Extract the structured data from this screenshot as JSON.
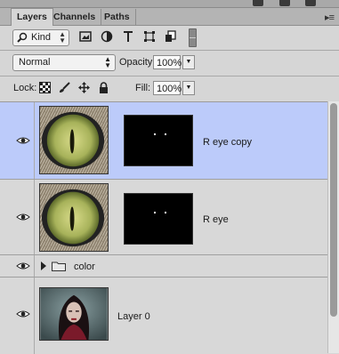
{
  "tabs": [
    {
      "label": "Layers",
      "active": true
    },
    {
      "label": "Channels",
      "active": false
    },
    {
      "label": "Paths",
      "active": false
    }
  ],
  "filter": {
    "kind_label": "Kind",
    "icons": [
      "pixel-filter-icon",
      "adjustment-filter-icon",
      "type-filter-icon",
      "shape-filter-icon",
      "smart-object-filter-icon",
      "filter-toggle-icon"
    ]
  },
  "blend": {
    "mode": "Normal",
    "opacity_label": "Opacity:",
    "opacity_value": "100%"
  },
  "lock": {
    "label": "Lock:",
    "icons": [
      "lock-transparent-icon",
      "lock-image-icon",
      "lock-position-icon",
      "lock-all-icon"
    ],
    "fill_label": "Fill:",
    "fill_value": "100%"
  },
  "layers": [
    {
      "name": "R eye copy",
      "selected": true,
      "visible": true,
      "type": "image-with-mask"
    },
    {
      "name": "R eye",
      "selected": false,
      "visible": true,
      "type": "image-with-mask"
    },
    {
      "name": "color",
      "selected": false,
      "visible": true,
      "type": "group"
    },
    {
      "name": "Layer 0",
      "selected": false,
      "visible": true,
      "type": "image"
    }
  ],
  "colors": {
    "selection": "#bccbfa",
    "panel": "#d6d6d6"
  }
}
